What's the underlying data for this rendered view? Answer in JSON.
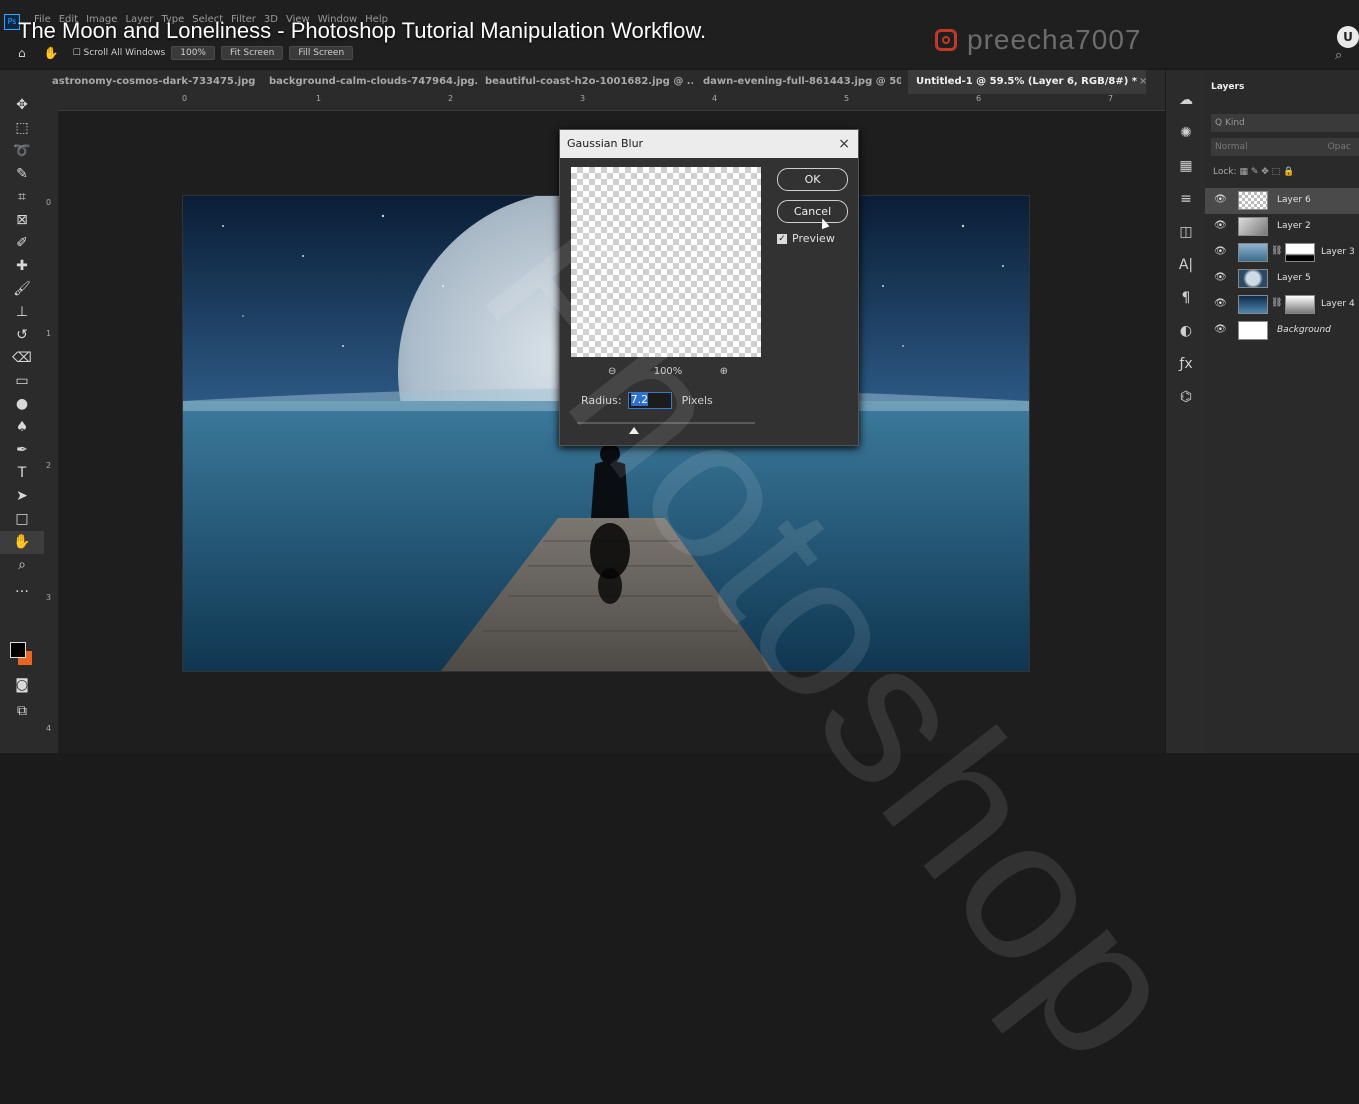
{
  "video_title": "The Moon and Loneliness - Photoshop Tutorial Manipulation Workflow.",
  "watermark": {
    "instagram_handle": "preecha7007",
    "diagonal_text": "Photoshop"
  },
  "menu": {
    "app_icon": "Ps",
    "items": [
      "File",
      "Edit",
      "Image",
      "Layer",
      "Type",
      "Select",
      "Filter",
      "3D",
      "View",
      "Window",
      "Help"
    ]
  },
  "options_bar": {
    "scroll_all_windows": "Scroll All Windows",
    "zoom": "100%",
    "fit_screen": "Fit Screen",
    "fill_screen": "Fill Screen"
  },
  "user_avatar_letter": "U",
  "doc_tabs": [
    {
      "label": "astronomy-cosmos-dark-733475.jpg .",
      "close": "×"
    },
    {
      "label": "background-calm-clouds-747964.jpg.",
      "close": "×"
    },
    {
      "label": "beautiful-coast-h2o-1001682.jpg @ ...",
      "close": "×"
    },
    {
      "label": "dawn-evening-full-861443.jpg @ 50...",
      "close": "×"
    },
    {
      "label": "Untitled-1 @ 59.5% (Layer 6, RGB/8#) *",
      "close": "×"
    }
  ],
  "ruler_top_labels": [
    "0",
    "1",
    "2",
    "3",
    "4",
    "5",
    "6",
    "7"
  ],
  "ruler_left_labels": [
    "0",
    "1",
    "2",
    "3",
    "4"
  ],
  "dialog": {
    "title": "Gaussian Blur",
    "close": "×",
    "ok": "OK",
    "cancel": "Cancel",
    "preview_label": "Preview",
    "preview_checked": true,
    "zoom_value": "100%",
    "zoom_out": "⊖",
    "zoom_in": "⊕",
    "radius_label": "Radius:",
    "radius_value": "7.2",
    "radius_unit": "Pixels",
    "radius_slider_fraction": 0.32
  },
  "layers_panel": {
    "tab_label": "Layers",
    "filter_label": "Q Kind",
    "blend_mode": "Normal",
    "opacity_label": "Opac",
    "lock_label": "Lock:",
    "layers": [
      {
        "name": "Layer 6",
        "active": true,
        "has_mask": false
      },
      {
        "name": "Layer 2",
        "active": false,
        "has_mask": false
      },
      {
        "name": "Layer 3",
        "active": false,
        "has_mask": true
      },
      {
        "name": "Layer 5",
        "active": false,
        "has_mask": false
      },
      {
        "name": "Layer 4",
        "active": false,
        "has_mask": true
      },
      {
        "name": "Background",
        "active": false,
        "has_mask": false
      }
    ]
  },
  "colors": {
    "accent": "#31a8ff",
    "background_color": "#e8661f",
    "foreground_color": "#000000"
  }
}
